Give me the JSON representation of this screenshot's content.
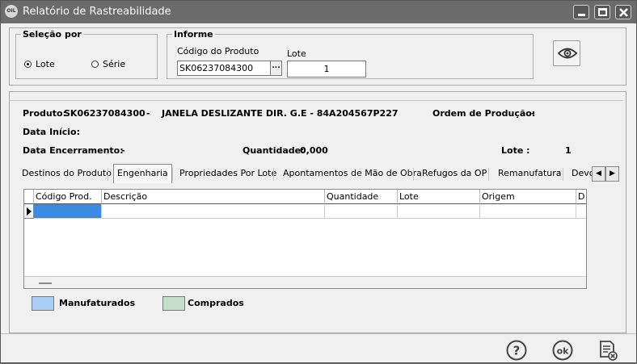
{
  "window": {
    "title": "Relatório de Rastreabilidade",
    "icon_text": "OIL"
  },
  "selecao": {
    "legend": "Seleção por",
    "options": [
      {
        "label": "Lote",
        "selected": true
      },
      {
        "label": "Série",
        "selected": false
      }
    ]
  },
  "informe": {
    "legend": "Informe",
    "codigo_label": "Código do Produto",
    "codigo_value": "SK06237084300",
    "lote_label": "Lote",
    "lote_value": "1",
    "lookup_label": "..."
  },
  "info": {
    "produto_label": "Produto:",
    "produto_code": "SK06237084300",
    "dash": "-",
    "produto_desc": "JANELA DESLIZANTE DIR. G.E - 84A204567P227",
    "ordem_label": "Ordem de Produção:",
    "ordem_value": "-",
    "data_inicio_label": "Data Início:",
    "data_enc_label": "Data Encerramento:",
    "data_enc_value": "-",
    "quantidade_label": "Quantidade:",
    "quantidade_value": "0,000",
    "lote_label": "Lote :",
    "lote_value": "1"
  },
  "tabs": [
    "Destinos do Produto",
    "Engenharia",
    "Propriedades Por Lote",
    "Apontamentos de Mão de Obra",
    "Refugos da OP",
    "Remanufatura",
    "Devo"
  ],
  "active_tab": "Engenharia",
  "grid": {
    "columns": [
      "Código Prod.",
      "Descrição",
      "Quantidade",
      "Lote",
      "Origem",
      "D"
    ]
  },
  "legend": [
    {
      "label": "Manufaturados",
      "color": "#a9cdf3"
    },
    {
      "label": "Comprados",
      "color": "#c3dec9"
    }
  ],
  "buttons": {
    "help": "?",
    "ok": "ok"
  }
}
